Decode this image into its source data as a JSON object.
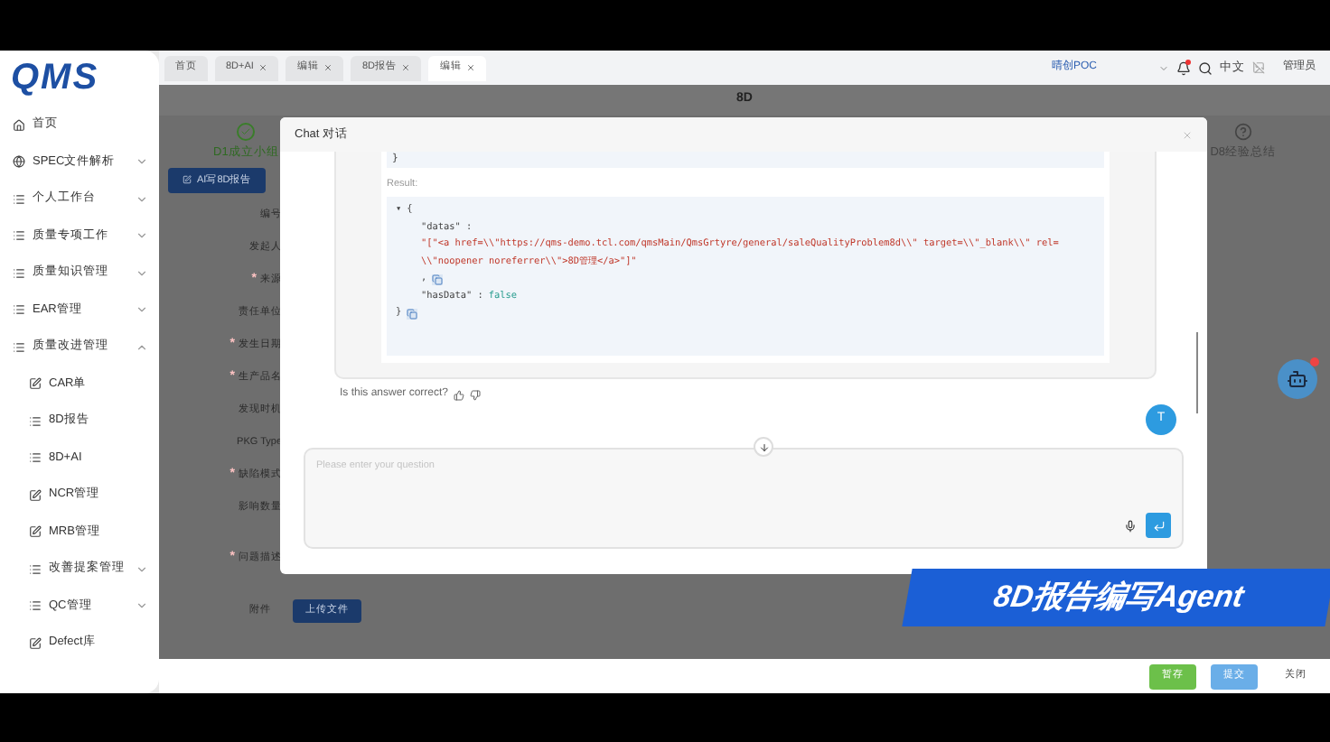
{
  "sidebar": {
    "logo": "QMS",
    "items": [
      {
        "label": "首页",
        "kind": "home"
      },
      {
        "label": "SPEC文件解析",
        "kind": "globe",
        "expanded": false
      },
      {
        "label": "个人工作台",
        "kind": "list",
        "expanded": false
      },
      {
        "label": "质量专项工作",
        "kind": "list",
        "expanded": false
      },
      {
        "label": "质量知识管理",
        "kind": "list",
        "expanded": false
      },
      {
        "label": "EAR管理",
        "kind": "list",
        "expanded": false
      },
      {
        "label": "质量改进管理",
        "kind": "list",
        "expanded": true,
        "children": [
          {
            "label": "CAR单",
            "kind": "edit"
          },
          {
            "label": "8D报告",
            "kind": "list"
          },
          {
            "label": "8D+AI",
            "kind": "list"
          },
          {
            "label": "NCR管理",
            "kind": "edit"
          },
          {
            "label": "MRB管理",
            "kind": "edit"
          },
          {
            "label": "改善提案管理",
            "kind": "list",
            "expanded": false
          },
          {
            "label": "QC管理",
            "kind": "list",
            "expanded": false
          },
          {
            "label": "Defect库",
            "kind": "edit"
          }
        ]
      }
    ]
  },
  "tabs": [
    {
      "label": "首页",
      "closable": false,
      "selected": false
    },
    {
      "label": "8D+AI",
      "closable": true,
      "selected": false
    },
    {
      "label": "编辑",
      "closable": true,
      "selected": false
    },
    {
      "label": "8D报告",
      "closable": true,
      "selected": false
    },
    {
      "label": "编辑",
      "closable": true,
      "selected": true
    }
  ],
  "header": {
    "org": "晴创POC",
    "language": "中文",
    "user": "管理员"
  },
  "page": {
    "title": "8D",
    "steps": [
      {
        "label": "D1成立小组",
        "completed": true
      },
      {
        "label": "D8经验总结",
        "completed": false
      }
    ],
    "ai_button": "AI写8D报告",
    "fields": [
      {
        "label": "编号"
      },
      {
        "label": "发起人"
      },
      {
        "label": "来源",
        "mark": "*"
      },
      {
        "label": "责任单位"
      },
      {
        "label": "发生日期",
        "mark": "*"
      },
      {
        "label": "生产品名",
        "mark": "*"
      },
      {
        "label": "发现时机"
      },
      {
        "label": "PKG Type"
      },
      {
        "label": "缺陷模式",
        "mark": "*"
      },
      {
        "label": "影响数量"
      },
      {
        "label": "问题描述",
        "mark": "*"
      }
    ],
    "attachment": {
      "label": "附件",
      "button": "上传文件"
    }
  },
  "chat": {
    "title": "Chat 对话",
    "code_tail": "}",
    "result_label": "Result:",
    "lines": [
      {
        "kind": "open",
        "toggle": "▾",
        "text": "{"
      },
      {
        "kind": "key",
        "text": "\"datas\" :"
      },
      {
        "kind": "string",
        "text": "\"[\"<a href=\\\\\"https://qms-demo.tcl.com/qmsMain/QmsGrtyre/general/saleQualityProblem8d\\\\\" target=\\\\\"_blank\\\\\" rel="
      },
      {
        "kind": "string",
        "text": "\\\\\"noopener noreferrer\\\\\">8D管理</a>\"]\""
      },
      {
        "kind": "copy",
        "text": ","
      },
      {
        "kind": "pair",
        "text": "\"hasData\" :",
        "value": "false"
      },
      {
        "kind": "close",
        "text": "}"
      }
    ],
    "feedback": "Is this answer correct?",
    "avatar": "T",
    "placeholder": "Please enter your question"
  },
  "banner": "8D报告编写Agent",
  "footer": [
    {
      "label": "暂存",
      "kind": "save"
    },
    {
      "label": "提交",
      "kind": "submit"
    },
    {
      "label": "关闭",
      "kind": "close"
    }
  ]
}
